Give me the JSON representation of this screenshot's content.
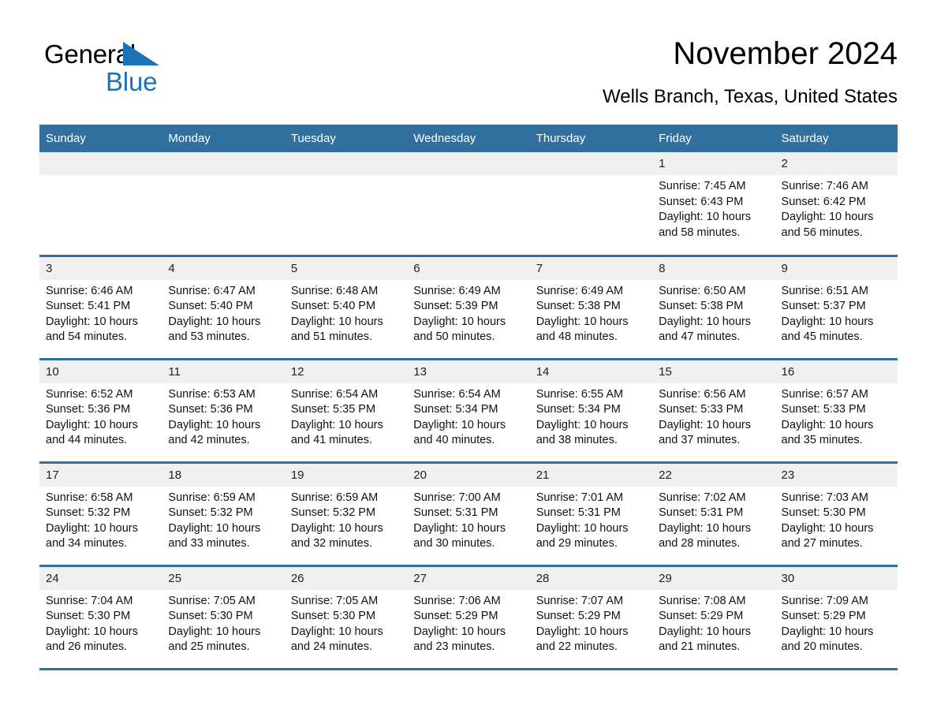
{
  "logo": {
    "word1": "General",
    "word2": "Blue",
    "triangle_color": "#1c72b8"
  },
  "header": {
    "month_title": "November 2024",
    "location": "Wells Branch, Texas, United States"
  },
  "theme": {
    "header_blue": "#31709e",
    "daynum_band": "#f0f0f0",
    "text": "#111111"
  },
  "weekday_headers": [
    "Sunday",
    "Monday",
    "Tuesday",
    "Wednesday",
    "Thursday",
    "Friday",
    "Saturday"
  ],
  "weeks": [
    [
      {
        "day": "",
        "empty": true
      },
      {
        "day": "",
        "empty": true
      },
      {
        "day": "",
        "empty": true
      },
      {
        "day": "",
        "empty": true
      },
      {
        "day": "",
        "empty": true
      },
      {
        "day": "1",
        "sunrise": "Sunrise: 7:45 AM",
        "sunset": "Sunset: 6:43 PM",
        "daylight": "Daylight: 10 hours and 58 minutes."
      },
      {
        "day": "2",
        "sunrise": "Sunrise: 7:46 AM",
        "sunset": "Sunset: 6:42 PM",
        "daylight": "Daylight: 10 hours and 56 minutes."
      }
    ],
    [
      {
        "day": "3",
        "sunrise": "Sunrise: 6:46 AM",
        "sunset": "Sunset: 5:41 PM",
        "daylight": "Daylight: 10 hours and 54 minutes."
      },
      {
        "day": "4",
        "sunrise": "Sunrise: 6:47 AM",
        "sunset": "Sunset: 5:40 PM",
        "daylight": "Daylight: 10 hours and 53 minutes."
      },
      {
        "day": "5",
        "sunrise": "Sunrise: 6:48 AM",
        "sunset": "Sunset: 5:40 PM",
        "daylight": "Daylight: 10 hours and 51 minutes."
      },
      {
        "day": "6",
        "sunrise": "Sunrise: 6:49 AM",
        "sunset": "Sunset: 5:39 PM",
        "daylight": "Daylight: 10 hours and 50 minutes."
      },
      {
        "day": "7",
        "sunrise": "Sunrise: 6:49 AM",
        "sunset": "Sunset: 5:38 PM",
        "daylight": "Daylight: 10 hours and 48 minutes."
      },
      {
        "day": "8",
        "sunrise": "Sunrise: 6:50 AM",
        "sunset": "Sunset: 5:38 PM",
        "daylight": "Daylight: 10 hours and 47 minutes."
      },
      {
        "day": "9",
        "sunrise": "Sunrise: 6:51 AM",
        "sunset": "Sunset: 5:37 PM",
        "daylight": "Daylight: 10 hours and 45 minutes."
      }
    ],
    [
      {
        "day": "10",
        "sunrise": "Sunrise: 6:52 AM",
        "sunset": "Sunset: 5:36 PM",
        "daylight": "Daylight: 10 hours and 44 minutes."
      },
      {
        "day": "11",
        "sunrise": "Sunrise: 6:53 AM",
        "sunset": "Sunset: 5:36 PM",
        "daylight": "Daylight: 10 hours and 42 minutes."
      },
      {
        "day": "12",
        "sunrise": "Sunrise: 6:54 AM",
        "sunset": "Sunset: 5:35 PM",
        "daylight": "Daylight: 10 hours and 41 minutes."
      },
      {
        "day": "13",
        "sunrise": "Sunrise: 6:54 AM",
        "sunset": "Sunset: 5:34 PM",
        "daylight": "Daylight: 10 hours and 40 minutes."
      },
      {
        "day": "14",
        "sunrise": "Sunrise: 6:55 AM",
        "sunset": "Sunset: 5:34 PM",
        "daylight": "Daylight: 10 hours and 38 minutes."
      },
      {
        "day": "15",
        "sunrise": "Sunrise: 6:56 AM",
        "sunset": "Sunset: 5:33 PM",
        "daylight": "Daylight: 10 hours and 37 minutes."
      },
      {
        "day": "16",
        "sunrise": "Sunrise: 6:57 AM",
        "sunset": "Sunset: 5:33 PM",
        "daylight": "Daylight: 10 hours and 35 minutes."
      }
    ],
    [
      {
        "day": "17",
        "sunrise": "Sunrise: 6:58 AM",
        "sunset": "Sunset: 5:32 PM",
        "daylight": "Daylight: 10 hours and 34 minutes."
      },
      {
        "day": "18",
        "sunrise": "Sunrise: 6:59 AM",
        "sunset": "Sunset: 5:32 PM",
        "daylight": "Daylight: 10 hours and 33 minutes."
      },
      {
        "day": "19",
        "sunrise": "Sunrise: 6:59 AM",
        "sunset": "Sunset: 5:32 PM",
        "daylight": "Daylight: 10 hours and 32 minutes."
      },
      {
        "day": "20",
        "sunrise": "Sunrise: 7:00 AM",
        "sunset": "Sunset: 5:31 PM",
        "daylight": "Daylight: 10 hours and 30 minutes."
      },
      {
        "day": "21",
        "sunrise": "Sunrise: 7:01 AM",
        "sunset": "Sunset: 5:31 PM",
        "daylight": "Daylight: 10 hours and 29 minutes."
      },
      {
        "day": "22",
        "sunrise": "Sunrise: 7:02 AM",
        "sunset": "Sunset: 5:31 PM",
        "daylight": "Daylight: 10 hours and 28 minutes."
      },
      {
        "day": "23",
        "sunrise": "Sunrise: 7:03 AM",
        "sunset": "Sunset: 5:30 PM",
        "daylight": "Daylight: 10 hours and 27 minutes."
      }
    ],
    [
      {
        "day": "24",
        "sunrise": "Sunrise: 7:04 AM",
        "sunset": "Sunset: 5:30 PM",
        "daylight": "Daylight: 10 hours and 26 minutes."
      },
      {
        "day": "25",
        "sunrise": "Sunrise: 7:05 AM",
        "sunset": "Sunset: 5:30 PM",
        "daylight": "Daylight: 10 hours and 25 minutes."
      },
      {
        "day": "26",
        "sunrise": "Sunrise: 7:05 AM",
        "sunset": "Sunset: 5:30 PM",
        "daylight": "Daylight: 10 hours and 24 minutes."
      },
      {
        "day": "27",
        "sunrise": "Sunrise: 7:06 AM",
        "sunset": "Sunset: 5:29 PM",
        "daylight": "Daylight: 10 hours and 23 minutes."
      },
      {
        "day": "28",
        "sunrise": "Sunrise: 7:07 AM",
        "sunset": "Sunset: 5:29 PM",
        "daylight": "Daylight: 10 hours and 22 minutes."
      },
      {
        "day": "29",
        "sunrise": "Sunrise: 7:08 AM",
        "sunset": "Sunset: 5:29 PM",
        "daylight": "Daylight: 10 hours and 21 minutes."
      },
      {
        "day": "30",
        "sunrise": "Sunrise: 7:09 AM",
        "sunset": "Sunset: 5:29 PM",
        "daylight": "Daylight: 10 hours and 20 minutes."
      }
    ]
  ]
}
